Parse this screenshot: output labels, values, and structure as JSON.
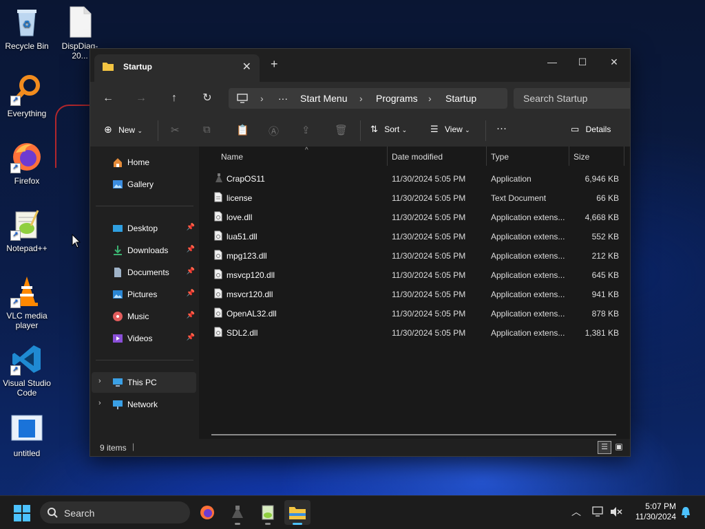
{
  "desktop": {
    "icons": [
      {
        "label": "Recycle Bin"
      },
      {
        "label": "DispDiag-20..."
      },
      {
        "label": "Everything"
      },
      {
        "label": "Firefox"
      },
      {
        "label": "Notepad++"
      },
      {
        "label": "VLC media player"
      },
      {
        "label": "Visual Studio Code"
      },
      {
        "label": "untitled"
      }
    ]
  },
  "window": {
    "tab_title": "Startup",
    "new_tab": "+",
    "controls": {
      "minimize": "—",
      "maximize": "☐",
      "close": "✕"
    }
  },
  "address": {
    "ellipsis": "···",
    "crumbs": [
      "Start Menu",
      "Programs",
      "Startup"
    ],
    "search_placeholder": "Search Startup"
  },
  "toolbar": {
    "new": "New",
    "sort": "Sort",
    "view": "View",
    "more": "···",
    "details": "Details"
  },
  "nav": {
    "home": "Home",
    "gallery": "Gallery",
    "quick": [
      "Desktop",
      "Downloads",
      "Documents",
      "Pictures",
      "Music",
      "Videos"
    ],
    "this_pc": "This PC",
    "network": "Network"
  },
  "columns": {
    "name": "Name",
    "date": "Date modified",
    "type": "Type",
    "size": "Size"
  },
  "files": [
    {
      "name": "CrapOS11",
      "date": "11/30/2024 5:05 PM",
      "type": "Application",
      "size": "6,946 KB",
      "icon": "app-icon"
    },
    {
      "name": "license",
      "date": "11/30/2024 5:05 PM",
      "type": "Text Document",
      "size": "66 KB",
      "icon": "text-file-icon"
    },
    {
      "name": "love.dll",
      "date": "11/30/2024 5:05 PM",
      "type": "Application extens...",
      "size": "4,668 KB",
      "icon": "dll-file-icon"
    },
    {
      "name": "lua51.dll",
      "date": "11/30/2024 5:05 PM",
      "type": "Application extens...",
      "size": "552 KB",
      "icon": "dll-file-icon"
    },
    {
      "name": "mpg123.dll",
      "date": "11/30/2024 5:05 PM",
      "type": "Application extens...",
      "size": "212 KB",
      "icon": "dll-file-icon"
    },
    {
      "name": "msvcp120.dll",
      "date": "11/30/2024 5:05 PM",
      "type": "Application extens...",
      "size": "645 KB",
      "icon": "dll-file-icon"
    },
    {
      "name": "msvcr120.dll",
      "date": "11/30/2024 5:05 PM",
      "type": "Application extens...",
      "size": "941 KB",
      "icon": "dll-file-icon"
    },
    {
      "name": "OpenAL32.dll",
      "date": "11/30/2024 5:05 PM",
      "type": "Application extens...",
      "size": "878 KB",
      "icon": "dll-file-icon"
    },
    {
      "name": "SDL2.dll",
      "date": "11/30/2024 5:05 PM",
      "type": "Application extens...",
      "size": "1,381 KB",
      "icon": "dll-file-icon"
    }
  ],
  "status": {
    "items": "9 items"
  },
  "taskbar": {
    "search": "Search",
    "time": "5:07 PM",
    "date": "11/30/2024"
  },
  "colors": {
    "accent": "#4cc2ff",
    "folder": "#f4c542"
  }
}
